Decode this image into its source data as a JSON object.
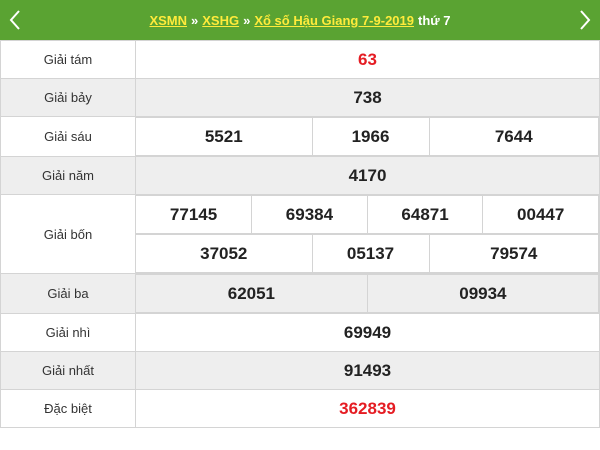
{
  "header": {
    "crumb1": "XSMN",
    "sep": "»",
    "crumb2": "XSHG",
    "title": "Xổ số Hậu Giang 7-9-2019",
    "weekday": "thứ 7"
  },
  "colors": {
    "header_bg": "#5aa332",
    "link": "#ffeb3b",
    "highlight": "#e51c23",
    "alt_row": "#eeeeee"
  },
  "icons": {
    "prev": "chevron-left-icon",
    "next": "chevron-right-icon"
  },
  "prizes": {
    "g8": {
      "label": "Giải tám",
      "numbers": [
        "63"
      ]
    },
    "g7": {
      "label": "Giải bảy",
      "numbers": [
        "738"
      ]
    },
    "g6": {
      "label": "Giải sáu",
      "numbers": [
        "5521",
        "1966",
        "7644"
      ]
    },
    "g5": {
      "label": "Giải năm",
      "numbers": [
        "4170"
      ]
    },
    "g4": {
      "label": "Giải bốn",
      "numbers": [
        "77145",
        "69384",
        "64871",
        "00447",
        "37052",
        "05137",
        "79574"
      ]
    },
    "g3": {
      "label": "Giải ba",
      "numbers": [
        "62051",
        "09934"
      ]
    },
    "g2": {
      "label": "Giải nhì",
      "numbers": [
        "69949"
      ]
    },
    "g1": {
      "label": "Giải nhất",
      "numbers": [
        "91493"
      ]
    },
    "db": {
      "label": "Đặc biệt",
      "numbers": [
        "362839"
      ]
    }
  }
}
